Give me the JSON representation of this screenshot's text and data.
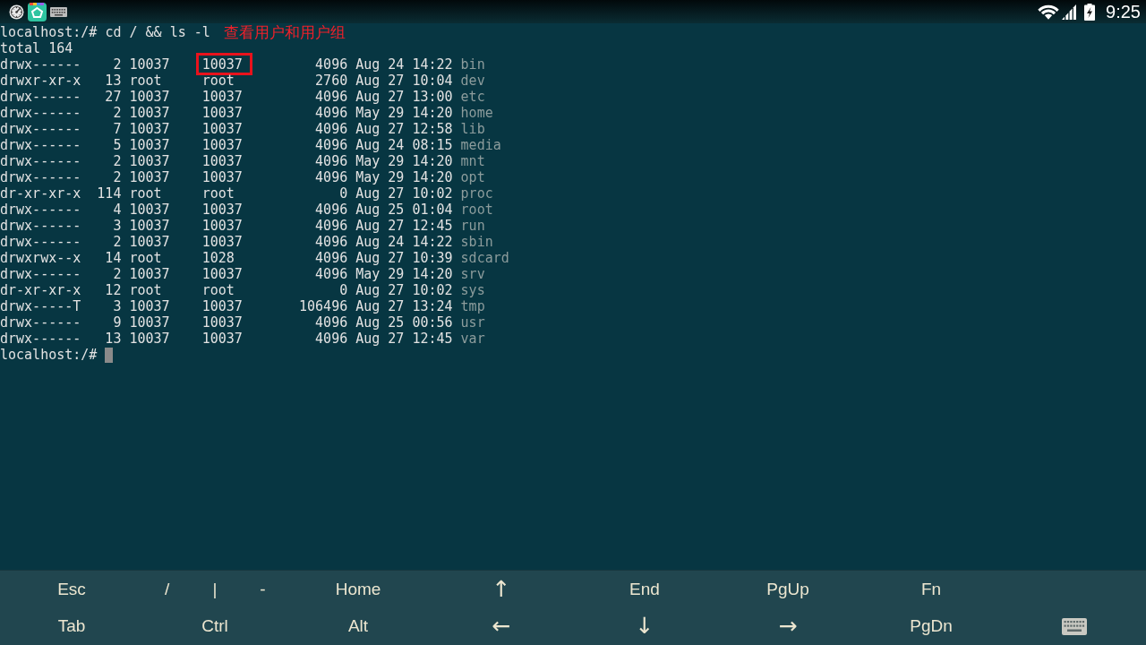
{
  "status_bar": {
    "time": "9:25"
  },
  "terminal": {
    "prompt": "localhost:/#",
    "command": "cd / && ls -l",
    "annotation": "查看用户和用户组",
    "total": "total 164",
    "rows": [
      {
        "perms": "drwx------",
        "links": "2",
        "owner": "10037",
        "group": "10037",
        "size": "4096",
        "date": "Aug 24 14:22",
        "name": "bin",
        "group_boxed": true
      },
      {
        "perms": "drwxr-xr-x",
        "links": "13",
        "owner": "root",
        "group": "root",
        "size": "2760",
        "date": "Aug 27 10:04",
        "name": "dev",
        "group_boxed": false
      },
      {
        "perms": "drwx------",
        "links": "27",
        "owner": "10037",
        "group": "10037",
        "size": "4096",
        "date": "Aug 27 13:00",
        "name": "etc",
        "group_boxed": false
      },
      {
        "perms": "drwx------",
        "links": "2",
        "owner": "10037",
        "group": "10037",
        "size": "4096",
        "date": "May 29 14:20",
        "name": "home",
        "group_boxed": false
      },
      {
        "perms": "drwx------",
        "links": "7",
        "owner": "10037",
        "group": "10037",
        "size": "4096",
        "date": "Aug 27 12:58",
        "name": "lib",
        "group_boxed": false
      },
      {
        "perms": "drwx------",
        "links": "5",
        "owner": "10037",
        "group": "10037",
        "size": "4096",
        "date": "Aug 24 08:15",
        "name": "media",
        "group_boxed": false
      },
      {
        "perms": "drwx------",
        "links": "2",
        "owner": "10037",
        "group": "10037",
        "size": "4096",
        "date": "May 29 14:20",
        "name": "mnt",
        "group_boxed": false
      },
      {
        "perms": "drwx------",
        "links": "2",
        "owner": "10037",
        "group": "10037",
        "size": "4096",
        "date": "May 29 14:20",
        "name": "opt",
        "group_boxed": false
      },
      {
        "perms": "dr-xr-xr-x",
        "links": "114",
        "owner": "root",
        "group": "root",
        "size": "0",
        "date": "Aug 27 10:02",
        "name": "proc",
        "group_boxed": false
      },
      {
        "perms": "drwx------",
        "links": "4",
        "owner": "10037",
        "group": "10037",
        "size": "4096",
        "date": "Aug 25 01:04",
        "name": "root",
        "group_boxed": false
      },
      {
        "perms": "drwx------",
        "links": "3",
        "owner": "10037",
        "group": "10037",
        "size": "4096",
        "date": "Aug 27 12:45",
        "name": "run",
        "group_boxed": false
      },
      {
        "perms": "drwx------",
        "links": "2",
        "owner": "10037",
        "group": "10037",
        "size": "4096",
        "date": "Aug 24 14:22",
        "name": "sbin",
        "group_boxed": false
      },
      {
        "perms": "drwxrwx--x",
        "links": "14",
        "owner": "root",
        "group": "1028",
        "size": "4096",
        "date": "Aug 27 10:39",
        "name": "sdcard",
        "group_boxed": false
      },
      {
        "perms": "drwx------",
        "links": "2",
        "owner": "10037",
        "group": "10037",
        "size": "4096",
        "date": "May 29 14:20",
        "name": "srv",
        "group_boxed": false
      },
      {
        "perms": "dr-xr-xr-x",
        "links": "12",
        "owner": "root",
        "group": "root",
        "size": "0",
        "date": "Aug 27 10:02",
        "name": "sys",
        "group_boxed": false
      },
      {
        "perms": "drwx-----T",
        "links": "3",
        "owner": "10037",
        "group": "10037",
        "size": "106496",
        "date": "Aug 27 13:24",
        "name": "tmp",
        "group_boxed": false
      },
      {
        "perms": "drwx------",
        "links": "9",
        "owner": "10037",
        "group": "10037",
        "size": "4096",
        "date": "Aug 25 00:56",
        "name": "usr",
        "group_boxed": false
      },
      {
        "perms": "drwx------",
        "links": "13",
        "owner": "10037",
        "group": "10037",
        "size": "4096",
        "date": "Aug 27 12:45",
        "name": "var",
        "group_boxed": false
      }
    ],
    "final_prompt": "localhost:/#"
  },
  "extra_keys": [
    [
      {
        "kind": "key",
        "label": "Esc"
      },
      {
        "kind": "group",
        "keys": [
          {
            "label": "/"
          },
          {
            "label": "|"
          },
          {
            "label": "-"
          }
        ]
      },
      {
        "kind": "key",
        "label": "Home"
      },
      {
        "kind": "arrow",
        "label": "↑"
      },
      {
        "kind": "key",
        "label": "End"
      },
      {
        "kind": "key",
        "label": "PgUp"
      },
      {
        "kind": "key",
        "label": "Fn"
      }
    ],
    [
      {
        "kind": "key",
        "label": "Tab"
      },
      {
        "kind": "key",
        "label": "Ctrl"
      },
      {
        "kind": "key",
        "label": "Alt"
      },
      {
        "kind": "arrow",
        "label": "←"
      },
      {
        "kind": "arrow",
        "label": "↓"
      },
      {
        "kind": "arrow",
        "label": "→"
      },
      {
        "kind": "key",
        "label": "PgDn"
      },
      {
        "kind": "keyboard"
      }
    ]
  ]
}
